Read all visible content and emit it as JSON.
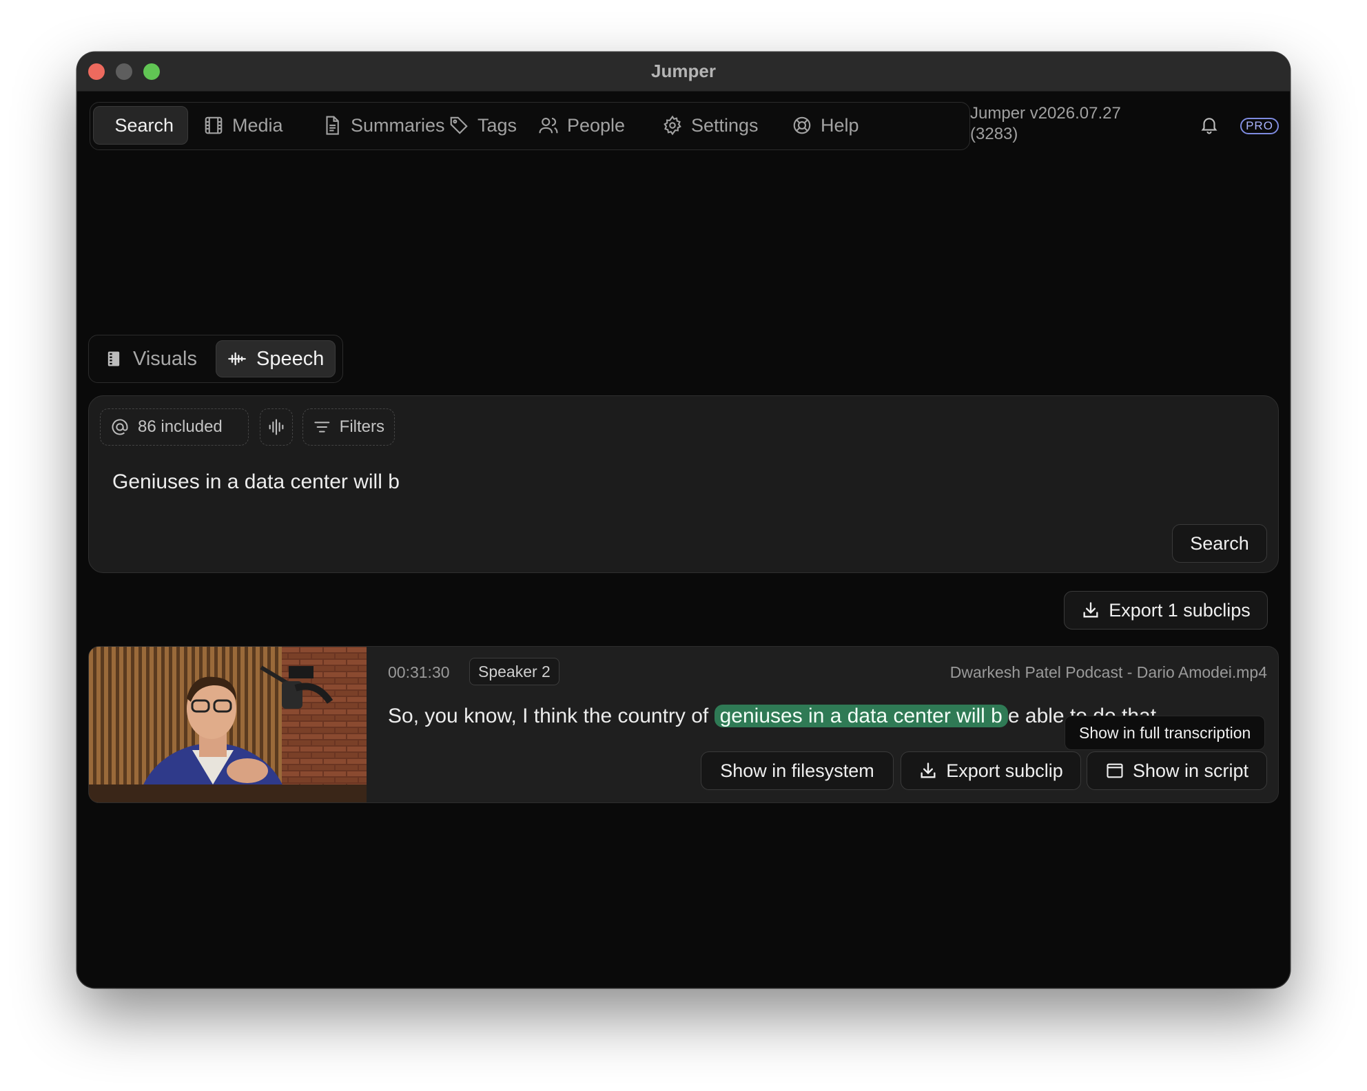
{
  "window": {
    "title": "Jumper"
  },
  "nav": {
    "items": [
      {
        "label": "Search",
        "icon": "search-icon",
        "active": true
      },
      {
        "label": "Media",
        "icon": "film-icon"
      },
      {
        "label": "Summaries",
        "icon": "document-icon"
      },
      {
        "label": "Tags",
        "icon": "tag-icon"
      },
      {
        "label": "People",
        "icon": "people-icon"
      },
      {
        "label": "Settings",
        "icon": "gear-icon"
      },
      {
        "label": "Help",
        "icon": "lifebuoy-icon"
      }
    ],
    "version_line1": "Jumper v2026.07.27",
    "version_line2": "(3283)",
    "pro_badge": "PRO"
  },
  "mode": {
    "visuals_label": "Visuals",
    "speech_label": "Speech",
    "active": "Speech"
  },
  "search": {
    "included_label": "86 included",
    "filters_label": "Filters",
    "query": "Geniuses in a data center will b",
    "search_button": "Search"
  },
  "export_all_label": "Export 1 subclips",
  "result": {
    "timestamp": "00:31:30",
    "speaker": "Speaker 2",
    "filename": "Dwarkesh Patel Podcast - Dario Amodei.mp4",
    "text_before": "So, you know, I think the country of ",
    "text_highlight": "geniuses in a data center will b",
    "text_after": "e able to do that",
    "tooltip": "Show in full transcription",
    "show_in_filesystem": "Show in filesystem",
    "export_subclip": "Export subclip",
    "show_in_script": "Show in script"
  },
  "colors": {
    "highlight": "#2f7a55",
    "pro_badge": "#7e8be0",
    "window_bg": "#0a0a0a",
    "panel_bg": "#1c1c1c"
  }
}
